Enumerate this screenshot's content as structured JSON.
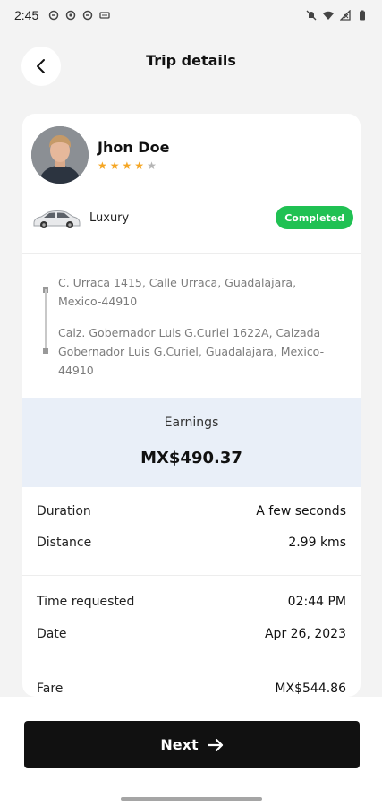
{
  "status_bar": {
    "time": "2:45"
  },
  "header": {
    "title": "Trip details"
  },
  "driver": {
    "name": "Jhon Doe",
    "rating": 4,
    "rating_max": 5,
    "star_color": "#f5a623",
    "star_empty_color": "#b5b5b5"
  },
  "vehicle": {
    "type": "Luxury",
    "status": "Completed",
    "status_color": "#20c153"
  },
  "route": {
    "pickup": "C. Urraca 1415, Calle Urraca, Guadalajara, Mexico-44910",
    "dropoff": "Calz. Gobernador Luis G.Curiel 1622A, Calzada Gobernador Luis G.Curiel, Guadalajara, Mexico-44910"
  },
  "earnings": {
    "label": "Earnings",
    "value": "MX$490.37"
  },
  "details": {
    "duration_label": "Duration",
    "duration_value": "A few seconds",
    "distance_label": "Distance",
    "distance_value": "2.99 kms",
    "time_requested_label": "Time requested",
    "time_requested_value": "02:44 PM",
    "date_label": "Date",
    "date_value": "Apr 26, 2023",
    "fare_label": "Fare",
    "fare_value": "MX$544.86"
  },
  "footer": {
    "next_label": "Next"
  }
}
